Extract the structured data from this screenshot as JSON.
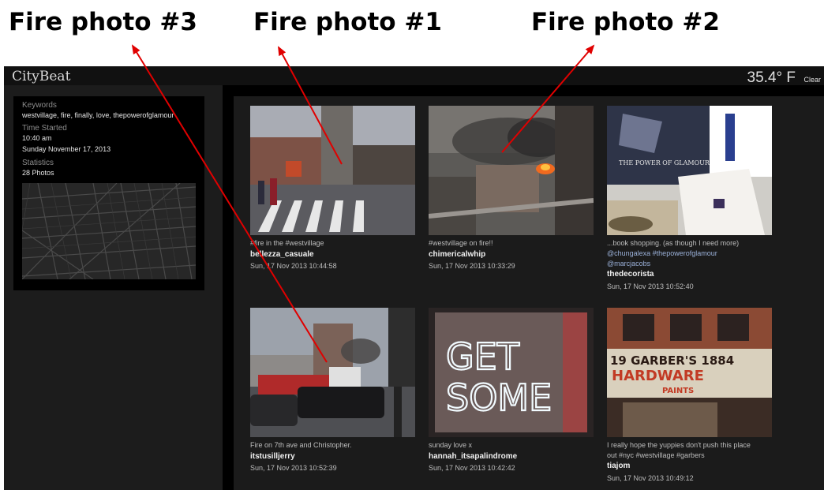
{
  "annotations": {
    "fire3": "Fire photo #3",
    "fire1": "Fire photo #1",
    "fire2": "Fire photo #2",
    "arrow_color": "#e00000"
  },
  "app": {
    "title": "CityBeat",
    "temperature": "35.4° F",
    "condition": "Clear"
  },
  "sidebar": {
    "keywords_label": "Keywords",
    "keywords_value": "westvillage, fire, finally, love, thepowerofglamour",
    "time_label": "Time Started",
    "time_value": "10:40 am",
    "date_value": "Sunday November 17, 2013",
    "stats_label": "Statistics",
    "stats_value": "28 Photos"
  },
  "photos": [
    {
      "caption_lines": [
        "#fire in the #westvillage"
      ],
      "user": "bellezza_casuale",
      "time": "Sun, 17 Nov 2013 10:44:58"
    },
    {
      "caption_lines": [
        "#westvillage on fire!!"
      ],
      "user": "chimericalwhip",
      "time": "Sun, 17 Nov 2013 10:33:29"
    },
    {
      "caption_lines": [
        "...book shopping. (as though I need more)",
        "@chungalexa #thepowerofglamour",
        "@marcjacobs"
      ],
      "user": "thedecorista",
      "time": "Sun, 17 Nov 2013 10:52:40"
    },
    {
      "caption_lines": [
        "Fire on 7th ave and Christopher."
      ],
      "user": "itstusilljerry",
      "time": "Sun, 17 Nov 2013 10:52:39"
    },
    {
      "caption_lines": [
        "sunday love x"
      ],
      "user": "hannah_itsapalindrome",
      "time": "Sun, 17 Nov 2013 10:42:42"
    },
    {
      "caption_lines": [
        "I really hope the yuppies don't push this place",
        "out #nyc #westvillage #garbers"
      ],
      "user": "tiajom",
      "time": "Sun, 17 Nov 2013 10:49:12"
    }
  ],
  "photo_text": {
    "neon": [
      "GET",
      "SOME"
    ],
    "book_cover": "THE POWER OF GLAMOUR",
    "sign_line1": "19 GARBER'S 1884",
    "sign_line2": "HARDWARE",
    "sign_line3": "PAINTS"
  }
}
